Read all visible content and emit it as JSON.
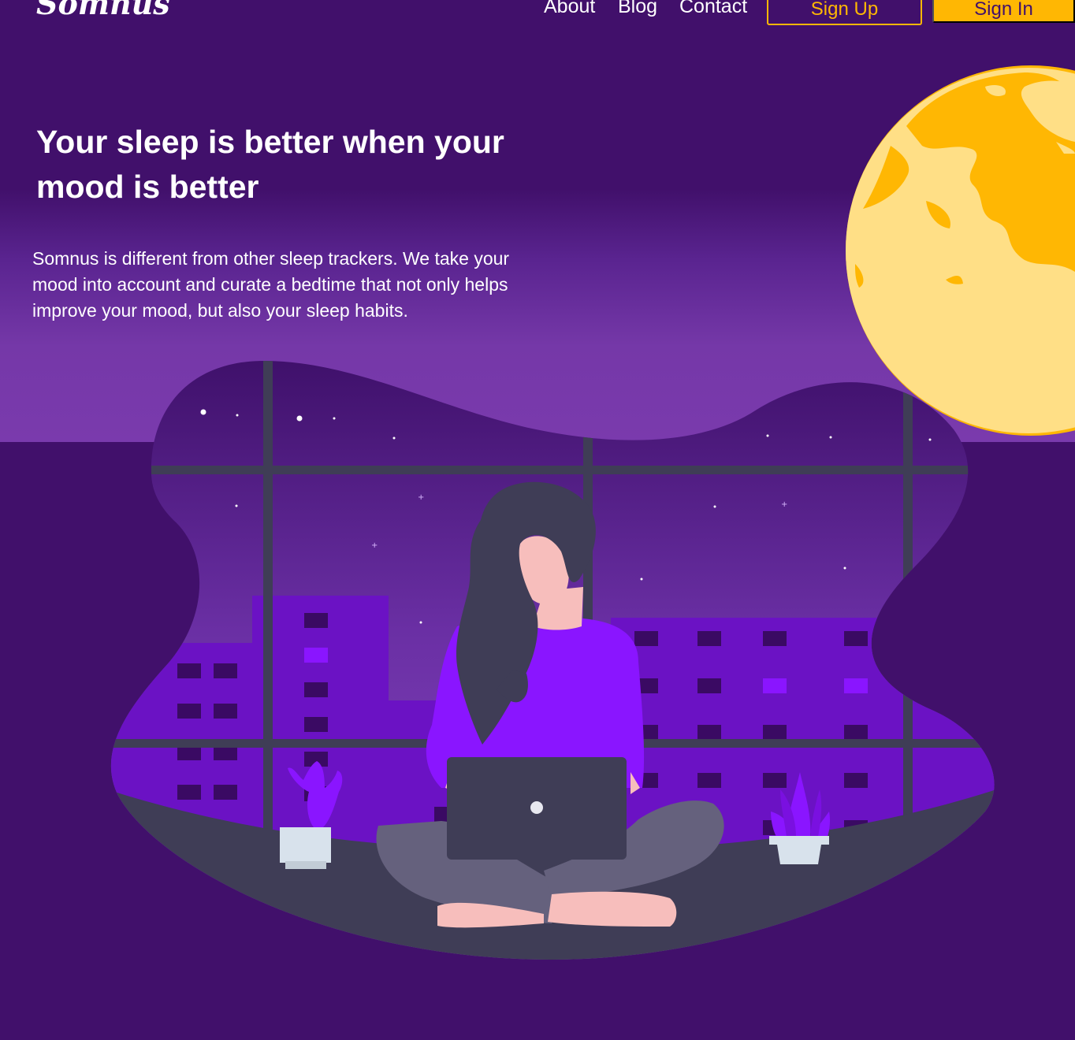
{
  "nav": {
    "logo": "Somnus",
    "about": "About",
    "blog": "Blog",
    "contact": "Contact",
    "sign_up": "Sign Up",
    "sign_in": "Sign In"
  },
  "hero": {
    "headline": "Your sleep is better when your mood is better",
    "description": "Somnus is different from other sleep trackers. We take your mood into account and curate a bedtime that not only helps improve your mood, but also your sleep habits."
  },
  "colors": {
    "background": "#41106b",
    "accent": "#ffb703",
    "moon": "#ffdf86",
    "shirt": "#8a15ff",
    "window_frame": "#3f3d56"
  },
  "icons": {
    "moon": "moon-illustration",
    "cactus": "cactus-plant-icon",
    "plant": "potted-plant-icon",
    "laptop": "laptop-icon"
  }
}
